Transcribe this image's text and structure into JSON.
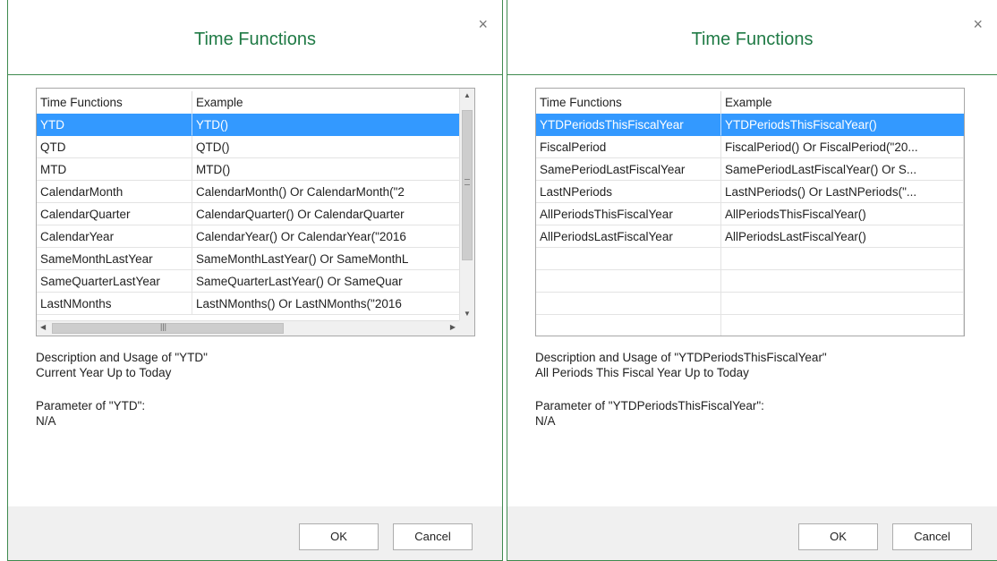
{
  "left_dialog": {
    "title": "Time Functions",
    "close_glyph": "×",
    "columns": [
      "Time Functions",
      "Example"
    ],
    "rows": [
      {
        "name": "YTD",
        "example": "YTD()"
      },
      {
        "name": "QTD",
        "example": "QTD()"
      },
      {
        "name": "MTD",
        "example": "MTD()"
      },
      {
        "name": "CalendarMonth",
        "example": "CalendarMonth() Or CalendarMonth(\"2"
      },
      {
        "name": "CalendarQuarter",
        "example": "CalendarQuarter() Or CalendarQuarter"
      },
      {
        "name": "CalendarYear",
        "example": "CalendarYear() Or CalendarYear(\"2016"
      },
      {
        "name": "SameMonthLastYear",
        "example": "SameMonthLastYear() Or SameMonthL"
      },
      {
        "name": "SameQuarterLastYear",
        "example": "SameQuarterLastYear() Or SameQuar"
      },
      {
        "name": "LastNMonths",
        "example": "LastNMonths() Or LastNMonths(\"2016"
      }
    ],
    "selected_index": 0,
    "description_heading": "Description and Usage of \"YTD\"",
    "description_text": "Current Year Up to Today",
    "parameter_heading": "Parameter of \"YTD\":",
    "parameter_text": "N/A",
    "ok_label": "OK",
    "cancel_label": "Cancel"
  },
  "right_dialog": {
    "title": "Time Functions",
    "close_glyph": "×",
    "columns": [
      "Time Functions",
      "Example"
    ],
    "rows": [
      {
        "name": "YTDPeriodsThisFiscalYear",
        "example": "YTDPeriodsThisFiscalYear()"
      },
      {
        "name": "FiscalPeriod",
        "example": "FiscalPeriod() Or FiscalPeriod(\"20..."
      },
      {
        "name": "SamePeriodLastFiscalYear",
        "example": "SamePeriodLastFiscalYear() Or S..."
      },
      {
        "name": "LastNPeriods",
        "example": "LastNPeriods() Or LastNPeriods(\"..."
      },
      {
        "name": "AllPeriodsThisFiscalYear",
        "example": "AllPeriodsThisFiscalYear()"
      },
      {
        "name": "AllPeriodsLastFiscalYear",
        "example": "AllPeriodsLastFiscalYear()"
      }
    ],
    "selected_index": 0,
    "description_heading": "Description and Usage of \"YTDPeriodsThisFiscalYear\"",
    "description_text": "All Periods This Fiscal Year Up to Today",
    "parameter_heading": "Parameter of \"YTDPeriodsThisFiscalYear\":",
    "parameter_text": "N/A",
    "ok_label": "OK",
    "cancel_label": "Cancel"
  },
  "colors": {
    "title": "#1f7a45",
    "border": "#3f8a4f",
    "selection": "#3399ff",
    "footer": "#f0f0f0"
  }
}
